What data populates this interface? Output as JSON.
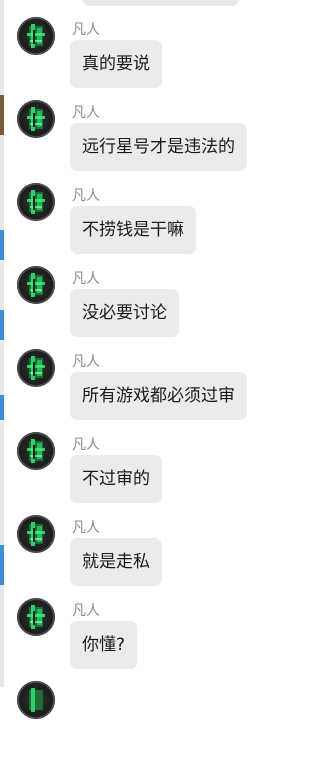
{
  "messages": [
    {
      "sender": "凡人",
      "text": "真的要说"
    },
    {
      "sender": "凡人",
      "text": "远行星号才是违法的"
    },
    {
      "sender": "凡人",
      "text": "不捞钱是干嘛"
    },
    {
      "sender": "凡人",
      "text": "没必要讨论"
    },
    {
      "sender": "凡人",
      "text": "所有游戏都必须过审"
    },
    {
      "sender": "凡人",
      "text": "不过审的"
    },
    {
      "sender": "凡人",
      "text": "就是走私"
    },
    {
      "sender": "凡人",
      "text": "你懂?"
    }
  ],
  "avatar_icon": "green-glitch-figure-icon"
}
